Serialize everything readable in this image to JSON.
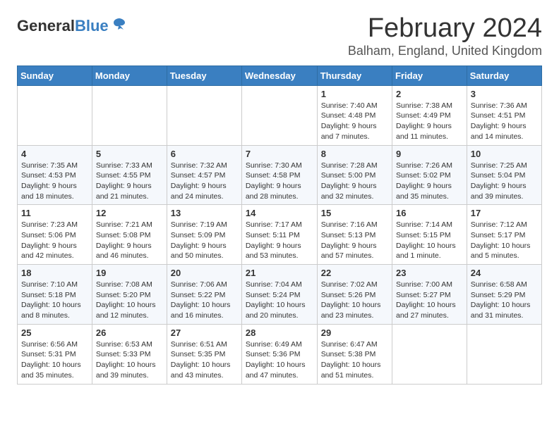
{
  "header": {
    "logo_general": "General",
    "logo_blue": "Blue",
    "title": "February 2024",
    "subtitle": "Balham, England, United Kingdom"
  },
  "days_of_week": [
    "Sunday",
    "Monday",
    "Tuesday",
    "Wednesday",
    "Thursday",
    "Friday",
    "Saturday"
  ],
  "weeks": [
    [
      {
        "day": "",
        "info": ""
      },
      {
        "day": "",
        "info": ""
      },
      {
        "day": "",
        "info": ""
      },
      {
        "day": "",
        "info": ""
      },
      {
        "day": "1",
        "info": "Sunrise: 7:40 AM\nSunset: 4:48 PM\nDaylight: 9 hours\nand 7 minutes."
      },
      {
        "day": "2",
        "info": "Sunrise: 7:38 AM\nSunset: 4:49 PM\nDaylight: 9 hours\nand 11 minutes."
      },
      {
        "day": "3",
        "info": "Sunrise: 7:36 AM\nSunset: 4:51 PM\nDaylight: 9 hours\nand 14 minutes."
      }
    ],
    [
      {
        "day": "4",
        "info": "Sunrise: 7:35 AM\nSunset: 4:53 PM\nDaylight: 9 hours\nand 18 minutes."
      },
      {
        "day": "5",
        "info": "Sunrise: 7:33 AM\nSunset: 4:55 PM\nDaylight: 9 hours\nand 21 minutes."
      },
      {
        "day": "6",
        "info": "Sunrise: 7:32 AM\nSunset: 4:57 PM\nDaylight: 9 hours\nand 24 minutes."
      },
      {
        "day": "7",
        "info": "Sunrise: 7:30 AM\nSunset: 4:58 PM\nDaylight: 9 hours\nand 28 minutes."
      },
      {
        "day": "8",
        "info": "Sunrise: 7:28 AM\nSunset: 5:00 PM\nDaylight: 9 hours\nand 32 minutes."
      },
      {
        "day": "9",
        "info": "Sunrise: 7:26 AM\nSunset: 5:02 PM\nDaylight: 9 hours\nand 35 minutes."
      },
      {
        "day": "10",
        "info": "Sunrise: 7:25 AM\nSunset: 5:04 PM\nDaylight: 9 hours\nand 39 minutes."
      }
    ],
    [
      {
        "day": "11",
        "info": "Sunrise: 7:23 AM\nSunset: 5:06 PM\nDaylight: 9 hours\nand 42 minutes."
      },
      {
        "day": "12",
        "info": "Sunrise: 7:21 AM\nSunset: 5:08 PM\nDaylight: 9 hours\nand 46 minutes."
      },
      {
        "day": "13",
        "info": "Sunrise: 7:19 AM\nSunset: 5:09 PM\nDaylight: 9 hours\nand 50 minutes."
      },
      {
        "day": "14",
        "info": "Sunrise: 7:17 AM\nSunset: 5:11 PM\nDaylight: 9 hours\nand 53 minutes."
      },
      {
        "day": "15",
        "info": "Sunrise: 7:16 AM\nSunset: 5:13 PM\nDaylight: 9 hours\nand 57 minutes."
      },
      {
        "day": "16",
        "info": "Sunrise: 7:14 AM\nSunset: 5:15 PM\nDaylight: 10 hours\nand 1 minute."
      },
      {
        "day": "17",
        "info": "Sunrise: 7:12 AM\nSunset: 5:17 PM\nDaylight: 10 hours\nand 5 minutes."
      }
    ],
    [
      {
        "day": "18",
        "info": "Sunrise: 7:10 AM\nSunset: 5:18 PM\nDaylight: 10 hours\nand 8 minutes."
      },
      {
        "day": "19",
        "info": "Sunrise: 7:08 AM\nSunset: 5:20 PM\nDaylight: 10 hours\nand 12 minutes."
      },
      {
        "day": "20",
        "info": "Sunrise: 7:06 AM\nSunset: 5:22 PM\nDaylight: 10 hours\nand 16 minutes."
      },
      {
        "day": "21",
        "info": "Sunrise: 7:04 AM\nSunset: 5:24 PM\nDaylight: 10 hours\nand 20 minutes."
      },
      {
        "day": "22",
        "info": "Sunrise: 7:02 AM\nSunset: 5:26 PM\nDaylight: 10 hours\nand 23 minutes."
      },
      {
        "day": "23",
        "info": "Sunrise: 7:00 AM\nSunset: 5:27 PM\nDaylight: 10 hours\nand 27 minutes."
      },
      {
        "day": "24",
        "info": "Sunrise: 6:58 AM\nSunset: 5:29 PM\nDaylight: 10 hours\nand 31 minutes."
      }
    ],
    [
      {
        "day": "25",
        "info": "Sunrise: 6:56 AM\nSunset: 5:31 PM\nDaylight: 10 hours\nand 35 minutes."
      },
      {
        "day": "26",
        "info": "Sunrise: 6:53 AM\nSunset: 5:33 PM\nDaylight: 10 hours\nand 39 minutes."
      },
      {
        "day": "27",
        "info": "Sunrise: 6:51 AM\nSunset: 5:35 PM\nDaylight: 10 hours\nand 43 minutes."
      },
      {
        "day": "28",
        "info": "Sunrise: 6:49 AM\nSunset: 5:36 PM\nDaylight: 10 hours\nand 47 minutes."
      },
      {
        "day": "29",
        "info": "Sunrise: 6:47 AM\nSunset: 5:38 PM\nDaylight: 10 hours\nand 51 minutes."
      },
      {
        "day": "",
        "info": ""
      },
      {
        "day": "",
        "info": ""
      }
    ]
  ]
}
